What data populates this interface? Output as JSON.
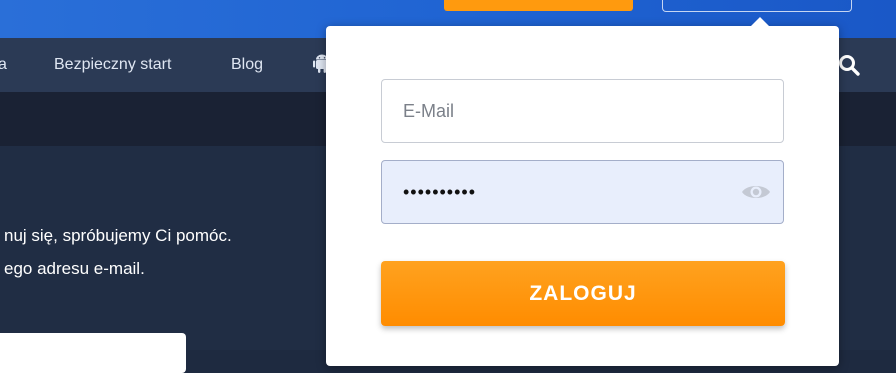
{
  "nav": {
    "items": [
      {
        "label": "a"
      },
      {
        "label": "Bezpieczny start"
      },
      {
        "label": "Blog"
      }
    ],
    "android_icon": "android-icon",
    "search_icon": "search-icon"
  },
  "content": {
    "line1": "nuj się, spróbujemy Ci pomóc.",
    "line2": "ego adresu e-mail."
  },
  "login": {
    "email_placeholder": "E-Mail",
    "email_value": "",
    "password_value": "••••••••••",
    "eye_icon": "eye-icon",
    "submit_label": "ZALOGUJ"
  },
  "colors": {
    "accent_orange": "#ff9a0e",
    "topbar_blue": "#2a6fd8",
    "navbar": "#2b3a55",
    "password_bg": "#e8eefc"
  }
}
